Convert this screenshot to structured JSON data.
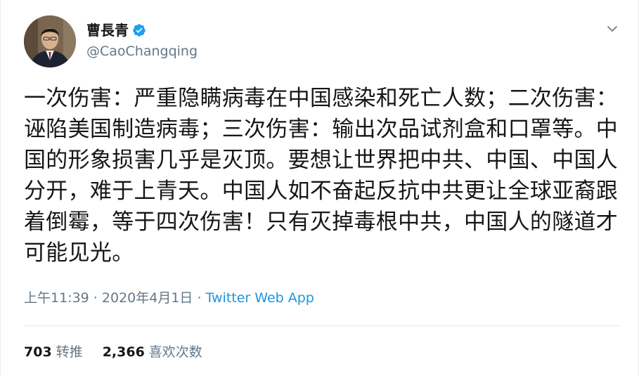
{
  "author": {
    "display_name": "曹長青",
    "handle": "@CaoChangqing",
    "verified": true
  },
  "icons": {
    "verified": "verified-badge-icon",
    "more": "chevron-down-icon"
  },
  "tweet": {
    "text": "一次伤害：严重隐瞒病毒在中国感染和死亡人数；二次伤害：诬陷美国制造病毒；三次伤害：输出次品试剂盒和口罩等。中国的形象损害几乎是灭顶。要想让世界把中共、中国、中国人分开，难于上青天。中国人如不奋起反抗中共更让全球亚裔跟着倒霉，等于四次伤害！只有灭掉毒根中共，中国人的隧道才可能见光。",
    "time": "上午11:39",
    "separator1": " · ",
    "date": "2020年4月1日",
    "separator2": " · ",
    "source": "Twitter Web App"
  },
  "stats": {
    "retweets_count": "703",
    "retweets_label": "转推",
    "likes_count": "2,366",
    "likes_label": "喜欢次数"
  },
  "colors": {
    "accent": "#1da1f2",
    "link": "#1b95e0",
    "secondary_text": "#657786",
    "primary_text": "#14171a",
    "divider": "#e6ecf0"
  }
}
